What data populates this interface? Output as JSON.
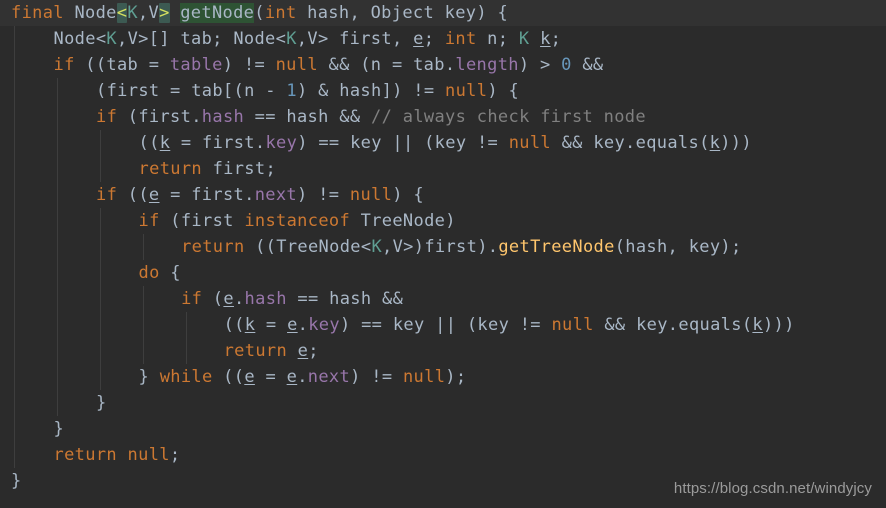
{
  "editor": {
    "theme_name": "darcula",
    "background": "#2b2b2b",
    "caret_row_background": "#323232",
    "foreground": "#a9b7c6",
    "keyword_color": "#cc7832",
    "field_color": "#9876aa",
    "number_color": "#6897bb",
    "comment_color": "#808080",
    "method_color": "#ffc66d",
    "bracket_match_background": "#3c5a52",
    "search_hit_background": "#2e5334",
    "language": "java"
  },
  "code": {
    "lines": [
      {
        "indent": 0,
        "caret_row": true,
        "tokens": [
          {
            "t": "final",
            "c": "kw"
          },
          {
            "t": " ",
            "c": "op"
          },
          {
            "t": "Node",
            "c": "id"
          },
          {
            "t": "<",
            "c": "brk"
          },
          {
            "t": "K",
            "c": "tp"
          },
          {
            "t": ",",
            "c": "tpv"
          },
          {
            "t": "V",
            "c": "tpv"
          },
          {
            "t": ">",
            "c": "brk"
          },
          {
            "t": " ",
            "c": "op"
          },
          {
            "t": "",
            "c": "caret"
          },
          {
            "t": "getNode",
            "c": "hit"
          },
          {
            "t": "(",
            "c": "op"
          },
          {
            "t": "int",
            "c": "kw"
          },
          {
            "t": " hash, Object key) {",
            "c": "id"
          }
        ]
      },
      {
        "indent": 1,
        "caret_row": false,
        "tokens": [
          {
            "t": "Node",
            "c": "id"
          },
          {
            "t": "<",
            "c": "op"
          },
          {
            "t": "K",
            "c": "tp"
          },
          {
            "t": ",",
            "c": "op"
          },
          {
            "t": "V",
            "c": "id"
          },
          {
            "t": ">[] tab; Node",
            "c": "id"
          },
          {
            "t": "<",
            "c": "op"
          },
          {
            "t": "K",
            "c": "tp"
          },
          {
            "t": ",",
            "c": "op"
          },
          {
            "t": "V",
            "c": "id"
          },
          {
            "t": "> first, ",
            "c": "id"
          },
          {
            "t": "e",
            "c": "und"
          },
          {
            "t": "; ",
            "c": "id"
          },
          {
            "t": "int",
            "c": "kw"
          },
          {
            "t": " n; ",
            "c": "id"
          },
          {
            "t": "K",
            "c": "tp"
          },
          {
            "t": " ",
            "c": "id"
          },
          {
            "t": "k",
            "c": "und"
          },
          {
            "t": ";",
            "c": "id"
          }
        ]
      },
      {
        "indent": 1,
        "caret_row": false,
        "tokens": [
          {
            "t": "if",
            "c": "kw"
          },
          {
            "t": " ((tab = ",
            "c": "id"
          },
          {
            "t": "table",
            "c": "fld"
          },
          {
            "t": ") != ",
            "c": "id"
          },
          {
            "t": "null",
            "c": "kw"
          },
          {
            "t": " && (n = tab.",
            "c": "id"
          },
          {
            "t": "length",
            "c": "fld"
          },
          {
            "t": ") > ",
            "c": "id"
          },
          {
            "t": "0",
            "c": "num"
          },
          {
            "t": " &&",
            "c": "id"
          }
        ]
      },
      {
        "indent": 2,
        "caret_row": false,
        "tokens": [
          {
            "t": "(first = tab[(n - ",
            "c": "id"
          },
          {
            "t": "1",
            "c": "num"
          },
          {
            "t": ") & hash]) != ",
            "c": "id"
          },
          {
            "t": "null",
            "c": "kw"
          },
          {
            "t": ") {",
            "c": "id"
          }
        ]
      },
      {
        "indent": 2,
        "caret_row": false,
        "tokens": [
          {
            "t": "if",
            "c": "kw"
          },
          {
            "t": " (first.",
            "c": "id"
          },
          {
            "t": "hash",
            "c": "fld"
          },
          {
            "t": " == hash && ",
            "c": "id"
          },
          {
            "t": "// always check first node",
            "c": "cmt"
          }
        ]
      },
      {
        "indent": 3,
        "caret_row": false,
        "tokens": [
          {
            "t": "((",
            "c": "id"
          },
          {
            "t": "k",
            "c": "und"
          },
          {
            "t": " = first.",
            "c": "id"
          },
          {
            "t": "key",
            "c": "fld"
          },
          {
            "t": ") == key || (key != ",
            "c": "id"
          },
          {
            "t": "null",
            "c": "kw"
          },
          {
            "t": " && key.equals(",
            "c": "id"
          },
          {
            "t": "k",
            "c": "und"
          },
          {
            "t": ")))",
            "c": "id"
          }
        ]
      },
      {
        "indent": 3,
        "caret_row": false,
        "tokens": [
          {
            "t": "return",
            "c": "kw"
          },
          {
            "t": " first;",
            "c": "id"
          }
        ]
      },
      {
        "indent": 2,
        "caret_row": false,
        "tokens": [
          {
            "t": "if",
            "c": "kw"
          },
          {
            "t": " ((",
            "c": "id"
          },
          {
            "t": "e",
            "c": "und"
          },
          {
            "t": " = first.",
            "c": "id"
          },
          {
            "t": "next",
            "c": "fld"
          },
          {
            "t": ") != ",
            "c": "id"
          },
          {
            "t": "null",
            "c": "kw"
          },
          {
            "t": ") {",
            "c": "id"
          }
        ]
      },
      {
        "indent": 3,
        "caret_row": false,
        "tokens": [
          {
            "t": "if",
            "c": "kw"
          },
          {
            "t": " (first ",
            "c": "id"
          },
          {
            "t": "instanceof",
            "c": "kw"
          },
          {
            "t": " TreeNode)",
            "c": "id"
          }
        ]
      },
      {
        "indent": 4,
        "caret_row": false,
        "tokens": [
          {
            "t": "return",
            "c": "kw"
          },
          {
            "t": " ((TreeNode",
            "c": "id"
          },
          {
            "t": "<",
            "c": "op"
          },
          {
            "t": "K",
            "c": "tp"
          },
          {
            "t": ",",
            "c": "op"
          },
          {
            "t": "V",
            "c": "id"
          },
          {
            "t": ">)first).",
            "c": "id"
          },
          {
            "t": "getTreeNode",
            "c": "mth"
          },
          {
            "t": "(hash, key);",
            "c": "id"
          }
        ]
      },
      {
        "indent": 3,
        "caret_row": false,
        "tokens": [
          {
            "t": "do",
            "c": "kw"
          },
          {
            "t": " {",
            "c": "id"
          }
        ]
      },
      {
        "indent": 4,
        "caret_row": false,
        "tokens": [
          {
            "t": "if",
            "c": "kw"
          },
          {
            "t": " (",
            "c": "id"
          },
          {
            "t": "e",
            "c": "und"
          },
          {
            "t": ".",
            "c": "id"
          },
          {
            "t": "hash",
            "c": "fld"
          },
          {
            "t": " == hash &&",
            "c": "id"
          }
        ]
      },
      {
        "indent": 5,
        "caret_row": false,
        "tokens": [
          {
            "t": "((",
            "c": "id"
          },
          {
            "t": "k",
            "c": "und"
          },
          {
            "t": " = ",
            "c": "id"
          },
          {
            "t": "e",
            "c": "und"
          },
          {
            "t": ".",
            "c": "id"
          },
          {
            "t": "key",
            "c": "fld"
          },
          {
            "t": ") == key || (key != ",
            "c": "id"
          },
          {
            "t": "null",
            "c": "kw"
          },
          {
            "t": " && key.equals(",
            "c": "id"
          },
          {
            "t": "k",
            "c": "und"
          },
          {
            "t": ")))",
            "c": "id"
          }
        ]
      },
      {
        "indent": 5,
        "caret_row": false,
        "tokens": [
          {
            "t": "return",
            "c": "kw"
          },
          {
            "t": " ",
            "c": "id"
          },
          {
            "t": "e",
            "c": "und"
          },
          {
            "t": ";",
            "c": "id"
          }
        ]
      },
      {
        "indent": 3,
        "caret_row": false,
        "tokens": [
          {
            "t": "} ",
            "c": "id"
          },
          {
            "t": "while",
            "c": "kw"
          },
          {
            "t": " ((",
            "c": "id"
          },
          {
            "t": "e",
            "c": "und"
          },
          {
            "t": " = ",
            "c": "id"
          },
          {
            "t": "e",
            "c": "und"
          },
          {
            "t": ".",
            "c": "id"
          },
          {
            "t": "next",
            "c": "fld"
          },
          {
            "t": ") != ",
            "c": "id"
          },
          {
            "t": "null",
            "c": "kw"
          },
          {
            "t": ");",
            "c": "id"
          }
        ]
      },
      {
        "indent": 2,
        "caret_row": false,
        "tokens": [
          {
            "t": "}",
            "c": "id"
          }
        ]
      },
      {
        "indent": 1,
        "caret_row": false,
        "tokens": [
          {
            "t": "}",
            "c": "id"
          }
        ]
      },
      {
        "indent": 1,
        "caret_row": false,
        "tokens": [
          {
            "t": "return",
            "c": "kw"
          },
          {
            "t": " ",
            "c": "id"
          },
          {
            "t": "null",
            "c": "kw"
          },
          {
            "t": ";",
            "c": "id"
          }
        ]
      },
      {
        "indent": 0,
        "caret_row": false,
        "tokens": [
          {
            "t": "}",
            "c": "id"
          }
        ]
      }
    ],
    "indent_guides_x": [
      14,
      57,
      100,
      143,
      186,
      229
    ]
  },
  "watermark": {
    "text": "https://blog.csdn.net/windyjcy"
  }
}
